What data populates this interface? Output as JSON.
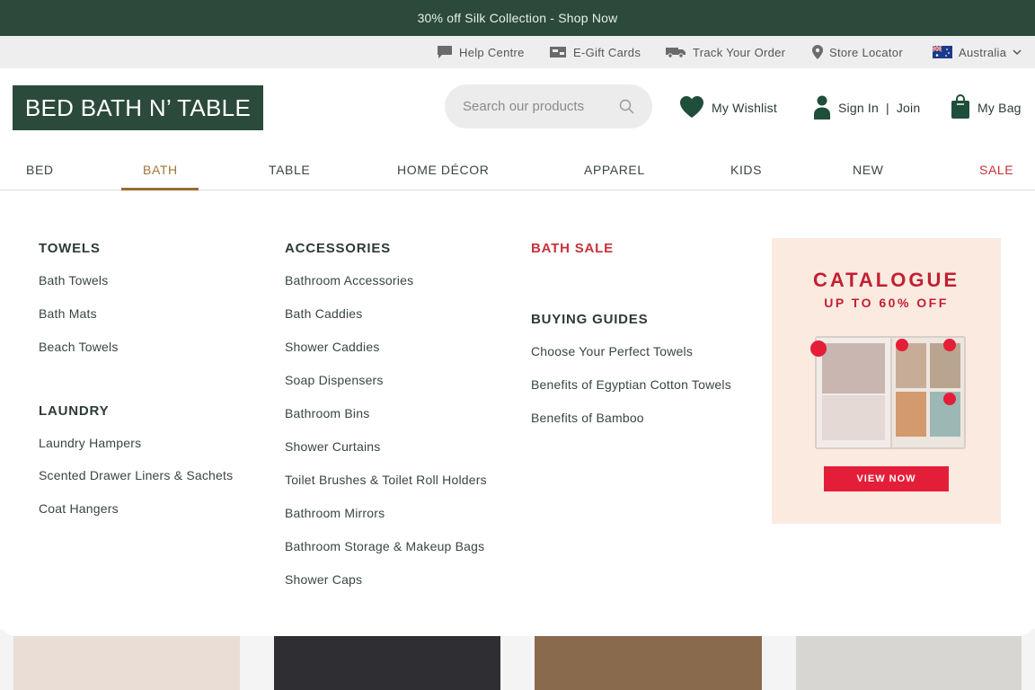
{
  "promo_bar": {
    "text": "30% off Silk Collection - Shop Now"
  },
  "utility": {
    "help": "Help Centre",
    "egift": "E-Gift Cards",
    "track": "Track Your Order",
    "store": "Store Locator",
    "country": "Australia"
  },
  "header": {
    "logo": "BED BATH N’ TABLE",
    "search_placeholder": "Search our products",
    "wishlist": "My Wishlist",
    "signin": "Sign In",
    "join": "Join",
    "separator": "|",
    "bag": "My Bag"
  },
  "nav": {
    "items": [
      "BED",
      "BATH",
      "TABLE",
      "HOME DÉCOR",
      "APPAREL",
      "KIDS",
      "NEW",
      "SALE"
    ],
    "active": "BATH"
  },
  "mega": {
    "towels": {
      "heading": "TOWELS",
      "links": [
        "Bath Towels",
        "Bath Mats",
        "Beach Towels"
      ]
    },
    "laundry": {
      "heading": "LAUNDRY",
      "links": [
        "Laundry Hampers",
        "Scented Drawer Liners & Sachets",
        "Coat Hangers"
      ]
    },
    "accessories": {
      "heading": "ACCESSORIES",
      "links": [
        "Bathroom Accessories",
        "Bath Caddies",
        "Shower Caddies",
        "Soap Dispensers",
        "Bathroom Bins",
        "Shower Curtains",
        "Toilet Brushes & Toilet Roll Holders",
        "Bathroom Mirrors",
        "Bathroom Storage & Makeup Bags",
        "Shower Caps"
      ]
    },
    "bath_sale": {
      "heading": "BATH SALE"
    },
    "guides": {
      "heading": "BUYING GUIDES",
      "links": [
        "Choose Your Perfect Towels",
        "Benefits of Egyptian Cotton Towels",
        "Benefits of Bamboo"
      ]
    },
    "promo_card": {
      "title": "CATALOGUE",
      "subtitle": "UP TO 60% OFF",
      "button": "VIEW NOW"
    }
  },
  "colors": {
    "brand_green": "#2b4a3c",
    "accent_gold": "#9a6b2f",
    "sale_red": "#c8313b",
    "utility_bg": "#eeeeee"
  }
}
